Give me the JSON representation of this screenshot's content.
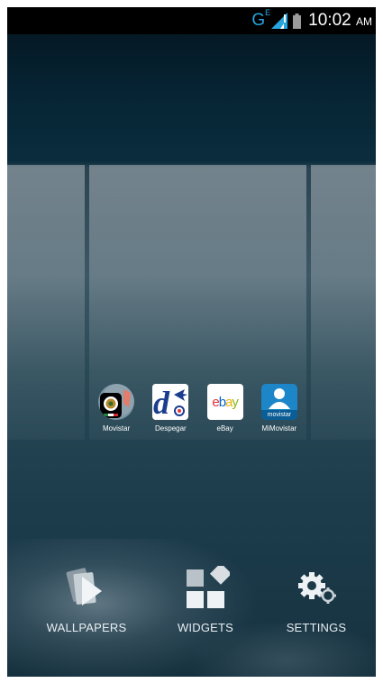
{
  "status_bar": {
    "network_type": "G",
    "network_sub": "E",
    "time": "10:02",
    "ampm": "AM",
    "accent_color": "#27a6de"
  },
  "apps": [
    {
      "label": "Movistar",
      "icon": "mexico-crest-icon"
    },
    {
      "label": "Despegar",
      "icon": "despegar-icon"
    },
    {
      "label": "eBay",
      "icon": "ebay-icon"
    },
    {
      "label": "MiMovistar",
      "icon": "mimovistar-icon",
      "badge": "movistar"
    }
  ],
  "ebay_logo": {
    "e": "e",
    "b": "b",
    "a": "a",
    "y": "y"
  },
  "options": {
    "wallpapers": "WALLPAPERS",
    "widgets": "WIDGETS",
    "settings": "SETTINGS"
  }
}
